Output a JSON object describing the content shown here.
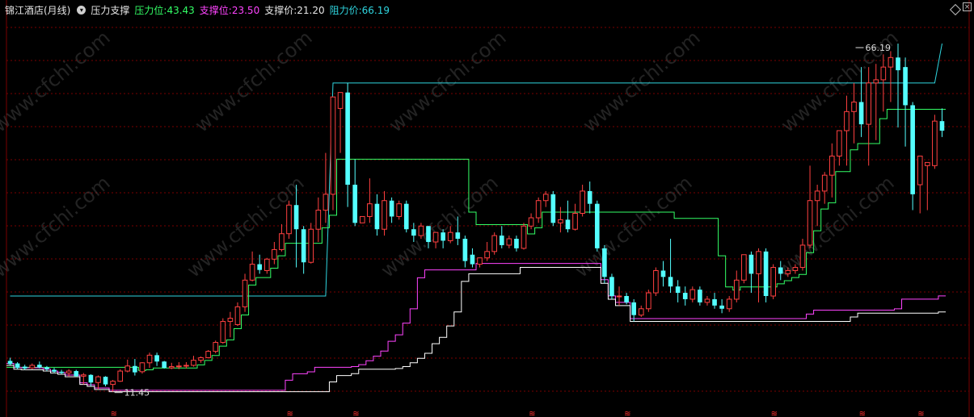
{
  "legend": {
    "stock_name": "锦江酒店(月线)",
    "indicator_name": "压力支撑",
    "pressure_label": "压力位:",
    "pressure_value": "43.43",
    "support_label": "支撑位:",
    "support_value": "23.50",
    "support_price_label": "支撑价:",
    "support_price_value": "21.20",
    "resistance_label": "阻力价:",
    "resistance_value": "66.19"
  },
  "watermark_text": "www.cfchi.com",
  "colors": {
    "background": "#000000",
    "grid": "#7a0000",
    "up_candle": "#ff4040",
    "down_candle": "#54ffff",
    "resistance_line": "#2fd6e0",
    "pressure_line": "#33ff66",
    "support_line": "#ff44ff",
    "support_price_line": "#ffffff"
  },
  "chart_data": {
    "type": "candlestick",
    "title": "锦江酒店(月线)",
    "ylim": [
      9,
      70
    ],
    "grid": true,
    "annotations": [
      {
        "text": "66.19",
        "index": 115,
        "value": 66.19,
        "kind": "high"
      },
      {
        "text": "11.45",
        "index": 14,
        "value": 11.45,
        "kind": "low"
      }
    ],
    "ohlc": [
      [
        16.3,
        16.8,
        15.8,
        15.6
      ],
      [
        15.9,
        16.1,
        15.2,
        15.0
      ],
      [
        15.4,
        15.7,
        15.1,
        14.9
      ],
      [
        15.2,
        15.9,
        15.6,
        15.0
      ],
      [
        15.7,
        16.2,
        15.3,
        15.1
      ],
      [
        15.3,
        15.5,
        15.0,
        14.7
      ],
      [
        14.9,
        15.2,
        14.6,
        14.4
      ],
      [
        14.6,
        14.9,
        14.4,
        14.2
      ],
      [
        14.4,
        15.0,
        14.7,
        13.8
      ],
      [
        14.7,
        14.9,
        13.9,
        13.8
      ],
      [
        13.9,
        14.4,
        14.1,
        12.6
      ],
      [
        14.1,
        14.2,
        12.9,
        12.3
      ],
      [
        12.9,
        14.0,
        13.8,
        11.8
      ],
      [
        13.8,
        13.9,
        12.6,
        12.3
      ],
      [
        12.6,
        13.3,
        13.1,
        11.45
      ],
      [
        13.1,
        15.0,
        14.7,
        13.0
      ],
      [
        14.7,
        16.5,
        15.5,
        14.5
      ],
      [
        15.5,
        16.6,
        14.5,
        14.0
      ],
      [
        14.6,
        16.1,
        16.0,
        14.3
      ],
      [
        16.0,
        17.6,
        17.2,
        15.2
      ],
      [
        17.2,
        17.6,
        16.2,
        15.5
      ],
      [
        16.2,
        16.3,
        15.2,
        15.1
      ],
      [
        15.2,
        16.0,
        15.4,
        15.0
      ],
      [
        15.4,
        16.1,
        15.5,
        15.0
      ],
      [
        15.5,
        16.1,
        15.6,
        15.1
      ],
      [
        15.6,
        17.1,
        16.4,
        15.4
      ],
      [
        16.4,
        17.0,
        16.8,
        16.0
      ],
      [
        16.8,
        18.0,
        17.8,
        16.7
      ],
      [
        17.8,
        19.5,
        19.2,
        17.5
      ],
      [
        19.2,
        23.0,
        22.5,
        19.0
      ],
      [
        22.5,
        24.0,
        23.0,
        20.0
      ],
      [
        22.0,
        25.5,
        24.8,
        21.8
      ],
      [
        24.8,
        30.0,
        29.0,
        24.0
      ],
      [
        29.0,
        33.5,
        31.5,
        28.8
      ],
      [
        31.5,
        33.0,
        30.6,
        30.0
      ],
      [
        30.5,
        32.5,
        32.3,
        30.0
      ],
      [
        32.3,
        35.0,
        33.8,
        31.5
      ],
      [
        33.8,
        37.8,
        36.3,
        33.5
      ],
      [
        36.3,
        41.5,
        40.8,
        35.5
      ],
      [
        40.8,
        44.0,
        37.0,
        31.0
      ],
      [
        37.0,
        37.5,
        31.8,
        30.0
      ],
      [
        31.8,
        38.0,
        37.0,
        31.6
      ],
      [
        37.0,
        42.0,
        40.0,
        35.0
      ],
      [
        40.0,
        49.0,
        42.5,
        38.0
      ],
      [
        42.5,
        54.0,
        57.8,
        40.0
      ],
      [
        56.0,
        58.0,
        58.5,
        49.0
      ],
      [
        58.5,
        60.0,
        44.0,
        40.5
      ],
      [
        44.0,
        48.0,
        38.0,
        37.5
      ],
      [
        38.0,
        39.0,
        39.0,
        38.0
      ],
      [
        39.0,
        45.0,
        41.0,
        38.0
      ],
      [
        41.0,
        42.5,
        37.0,
        36.0
      ],
      [
        37.0,
        43.0,
        41.5,
        36.0
      ],
      [
        41.5,
        42.0,
        39.0,
        38.0
      ],
      [
        39.0,
        41.5,
        41.0,
        38.5
      ],
      [
        41.0,
        41.5,
        37.0,
        36.5
      ],
      [
        37.0,
        38.0,
        36.0,
        35.0
      ],
      [
        36.0,
        38.0,
        37.5,
        35.5
      ],
      [
        37.5,
        37.5,
        35.0,
        34.0
      ],
      [
        35.0,
        36.5,
        36.5,
        34.0
      ],
      [
        36.5,
        37.0,
        35.2,
        34.0
      ],
      [
        35.2,
        37.5,
        36.5,
        34.8
      ],
      [
        36.5,
        39.0,
        35.5,
        34.5
      ],
      [
        35.5,
        36.0,
        32.0,
        31.0
      ],
      [
        33.0,
        34.0,
        31.5,
        31.0
      ],
      [
        31.5,
        32.5,
        32.5,
        31.0
      ],
      [
        32.5,
        35.0,
        33.5,
        32.0
      ],
      [
        33.5,
        36.5,
        36.0,
        33.0
      ],
      [
        36.0,
        37.5,
        34.5,
        34.0
      ],
      [
        34.5,
        36.0,
        35.5,
        34.0
      ],
      [
        35.5,
        36.0,
        34.0,
        33.5
      ],
      [
        34.0,
        38.0,
        37.5,
        33.8
      ],
      [
        37.5,
        39.5,
        38.8,
        37.0
      ],
      [
        38.8,
        42.0,
        41.5,
        38.0
      ],
      [
        41.5,
        43.0,
        42.5,
        40.5
      ],
      [
        42.5,
        43.0,
        38.0,
        37.5
      ],
      [
        38.0,
        40.5,
        38.5,
        36.5
      ],
      [
        38.5,
        41.5,
        37.0,
        36.5
      ],
      [
        37.0,
        41.0,
        39.5,
        36.8
      ],
      [
        39.5,
        44.0,
        43.0,
        39.0
      ],
      [
        43.0,
        44.5,
        41.0,
        39.5
      ],
      [
        41.0,
        41.5,
        34.0,
        33.5
      ],
      [
        34.0,
        34.5,
        29.5,
        28.5
      ],
      [
        29.5,
        30.0,
        26.5,
        26.0
      ],
      [
        26.5,
        28.0,
        26.5,
        25.0
      ],
      [
        26.5,
        27.0,
        25.5,
        25.2
      ],
      [
        25.5,
        26.0,
        23.5,
        22.5
      ],
      [
        23.5,
        25.0,
        24.5,
        23.2
      ],
      [
        24.5,
        27.5,
        27.0,
        24.0
      ],
      [
        27.0,
        31.0,
        30.5,
        26.5
      ],
      [
        30.5,
        32.0,
        29.5,
        28.0
      ],
      [
        29.5,
        35.5,
        28.0,
        27.0
      ],
      [
        28.0,
        29.0,
        27.0,
        25.5
      ],
      [
        27.0,
        28.0,
        26.0,
        25.0
      ],
      [
        26.0,
        28.0,
        27.5,
        25.5
      ],
      [
        27.5,
        28.0,
        25.5,
        25.0
      ],
      [
        25.5,
        26.5,
        26.0,
        25.0
      ],
      [
        26.0,
        27.0,
        25.0,
        24.5
      ],
      [
        25.0,
        26.0,
        24.5,
        23.8
      ],
      [
        24.5,
        26.5,
        26.0,
        24.0
      ],
      [
        26.0,
        30.5,
        29.0,
        25.5
      ],
      [
        29.0,
        33.0,
        33.0,
        28.5
      ],
      [
        33.0,
        33.5,
        30.0,
        27.0
      ],
      [
        30.0,
        34.0,
        33.5,
        25.5
      ],
      [
        33.5,
        34.0,
        26.5,
        25.5
      ],
      [
        26.5,
        31.5,
        31.0,
        26.0
      ],
      [
        31.0,
        32.0,
        30.0,
        29.0
      ],
      [
        30.0,
        31.0,
        30.5,
        29.5
      ],
      [
        30.5,
        31.5,
        31.0,
        30.0
      ],
      [
        31.0,
        35.5,
        34.5,
        30.5
      ],
      [
        34.5,
        47.0,
        41.5,
        34.0
      ],
      [
        41.5,
        44.0,
        43.0,
        37.5
      ],
      [
        43.0,
        46.0,
        45.5,
        41.0
      ],
      [
        45.5,
        50.5,
        48.5,
        42.0
      ],
      [
        48.5,
        51.5,
        52.5,
        47.0
      ],
      [
        52.5,
        58.0,
        55.5,
        47.0
      ],
      [
        55.5,
        60.0,
        57.0,
        50.5
      ],
      [
        57.0,
        62.5,
        53.5,
        51.5
      ],
      [
        53.5,
        62.5,
        60.0,
        47.0
      ],
      [
        60.0,
        63.0,
        60.5,
        51.0
      ],
      [
        60.5,
        64.5,
        62.5,
        55.5
      ],
      [
        62.5,
        65.0,
        64.0,
        57.0
      ],
      [
        64.0,
        66.19,
        62.0,
        53.0
      ],
      [
        62.5,
        64.0,
        56.5,
        50.0
      ],
      [
        56.5,
        57.0,
        42.5,
        40.0
      ],
      [
        44.0,
        48.5,
        48.5,
        39.5
      ],
      [
        47.0,
        47.5,
        47.5,
        40.0
      ],
      [
        47.0,
        55.0,
        54.0,
        46.5
      ],
      [
        54.0,
        56.0,
        52.5,
        51.5
      ]
    ],
    "lines": [
      {
        "name": "阻力价",
        "color": "#2fd6e0",
        "values": [
          26.5,
          26.5,
          26.5,
          26.5,
          26.5,
          26.5,
          26.5,
          26.5,
          26.5,
          26.5,
          26.5,
          26.5,
          26.5,
          26.5,
          26.5,
          26.5,
          26.5,
          26.5,
          26.5,
          26.5,
          26.5,
          26.5,
          26.5,
          26.5,
          26.5,
          26.5,
          26.5,
          26.5,
          26.5,
          26.5,
          26.5,
          26.5,
          26.5,
          26.5,
          26.5,
          26.5,
          26.5,
          26.5,
          26.5,
          26.5,
          26.5,
          26.5,
          26.5,
          26.5,
          60.0,
          60.0,
          60.0,
          60.0,
          60.0,
          60.0,
          60.0,
          60.0,
          60.0,
          60.0,
          60.0,
          60.0,
          60.0,
          60.0,
          60.0,
          60.0,
          60.0,
          60.0,
          60.0,
          60.0,
          60.0,
          60.0,
          60.0,
          60.0,
          60.0,
          60.0,
          60.0,
          60.0,
          60.0,
          60.0,
          60.0,
          60.0,
          60.0,
          60.0,
          60.0,
          60.0,
          60.0,
          60.0,
          60.0,
          60.0,
          60.0,
          60.0,
          60.0,
          60.0,
          60.0,
          60.0,
          60.0,
          60.0,
          60.0,
          60.0,
          60.0,
          60.0,
          60.0,
          60.0,
          60.0,
          60.0,
          60.0,
          60.0,
          60.0,
          60.0,
          60.0,
          60.0,
          60.0,
          60.0,
          60.0,
          60.0,
          60.0,
          60.0,
          60.0,
          60.0,
          60.0,
          60.0,
          60.0,
          60.0,
          60.0,
          60.0,
          60.0,
          60.0,
          60.0,
          60.0,
          60.0,
          60.0,
          60.0,
          66.19
        ]
      }
    ],
    "series_note_hidden": ""
  },
  "bottom_markers": [
    14,
    38,
    47,
    71,
    84,
    104,
    116,
    124
  ]
}
